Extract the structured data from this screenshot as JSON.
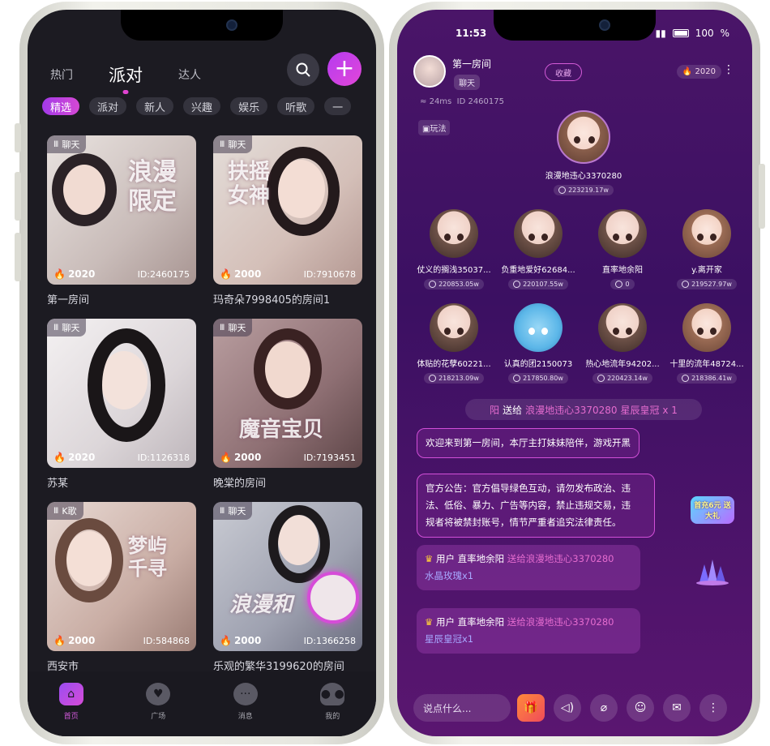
{
  "left": {
    "top_tabs": [
      "热门",
      "派对",
      "达人"
    ],
    "chips": [
      "精选",
      "派对",
      "新人",
      "兴趣",
      "娱乐",
      "听歌",
      "一"
    ],
    "cards": [
      {
        "tag": "聊天",
        "heat": "2020",
        "id": "ID:2460175",
        "name": "第一房间",
        "deco": "浪漫限定"
      },
      {
        "tag": "聊天",
        "heat": "2000",
        "id": "ID:7910678",
        "name": "玛奇朵7998405的房间1",
        "deco": "扶摇女神"
      },
      {
        "tag": "聊天",
        "heat": "2020",
        "id": "ID:1126318",
        "name": "苏某",
        "deco": ""
      },
      {
        "tag": "聊天",
        "heat": "2000",
        "id": "ID:7193451",
        "name": "晚棠的房间",
        "deco": "魔音宝贝"
      },
      {
        "tag": "K歌",
        "heat": "2000",
        "id": "ID:584868",
        "name": "西安市",
        "deco": "梦屿千寻"
      },
      {
        "tag": "聊天",
        "heat": "2000",
        "id": "ID:1366258",
        "name": "乐观的繁华3199620的房间",
        "deco": "浪漫和"
      }
    ],
    "bottom_nav": [
      "首页",
      "广场",
      "消息",
      "我的"
    ]
  },
  "right": {
    "status": {
      "time": "11:53",
      "battery": "100"
    },
    "room": {
      "title": "第一房间",
      "category": "聊天",
      "fav": "收藏",
      "heat": "2020",
      "ping": "24ms",
      "room_id": "ID 2460175",
      "play": "玩法"
    },
    "host": {
      "name": "浪漫地违心3370280",
      "score": "223219.17w"
    },
    "seats": [
      {
        "name": "仗义的搁浅35037...",
        "score": "220853.05w"
      },
      {
        "name": "负重地爱好62684...",
        "score": "220107.55w"
      },
      {
        "name": "直率地余阳",
        "score": "0"
      },
      {
        "name": "y.离开家",
        "score": "219527.97w"
      },
      {
        "name": "体贴的花孽60221...",
        "score": "218213.09w"
      },
      {
        "name": "认真的团2150073",
        "score": "217850.80w"
      },
      {
        "name": "热心地流年94202...",
        "score": "220423.14w"
      },
      {
        "name": "十里的流年48724...",
        "score": "218386.41w"
      }
    ],
    "gift_banner": {
      "from": "阳",
      "verb": "送给",
      "to": "浪漫地违心3370280",
      "gift": "星辰皇冠 x 1"
    },
    "messages": {
      "welcome": "欢迎来到第一房间，本厅主打妹妹陪伴，游戏开黑",
      "notice_1": "官方公告：官方倡导绿色互动，请勿发布政治、违",
      "notice_2": "法、低俗、暴力、广告等内容，禁止违规交易，违",
      "notice_3": "规者将被禁封账号，情节严重者追究法律责任。",
      "gift1_prefix": "用户 直率地余阳",
      "gift1_verb": "送给",
      "gift1_to": "浪漫地违心3370280",
      "gift1_item": "水晶玫瑰x1",
      "gift2_prefix": "用户 直率地余阳",
      "gift2_verb": "送给",
      "gift2_to": "浪漫地违心3370280",
      "gift2_item": "星辰皇冠x1"
    },
    "promo": "首充6元 送大礼",
    "input_placeholder": "说点什么..."
  }
}
